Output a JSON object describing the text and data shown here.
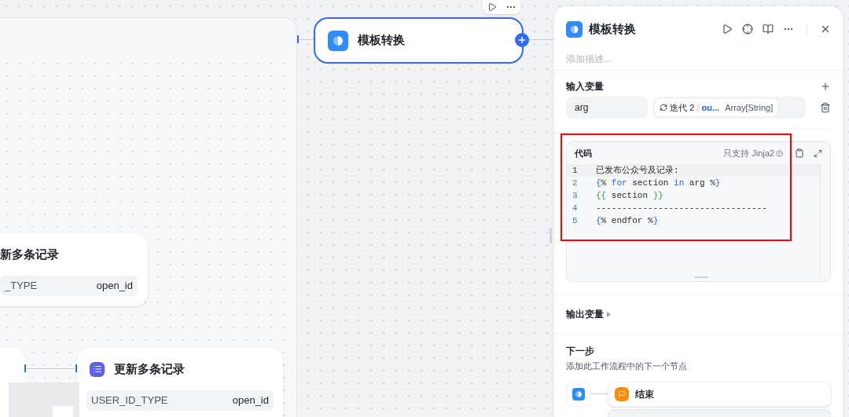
{
  "canvas": {
    "nodes": [
      {
        "title": "新多条记录",
        "param_name": "_TYPE",
        "param_value": "open_id"
      },
      {
        "title": "更新多条记录",
        "param_name": "USER_ID_TYPE",
        "param_value": "open_id"
      }
    ],
    "template_node": {
      "title": "模板转换",
      "selected": true
    }
  },
  "panel": {
    "title": "模板转换",
    "description_placeholder": "添加描述...",
    "input_section": "输入变量",
    "inputs": [
      {
        "name": "arg",
        "source": "迭代 2",
        "separator": "/",
        "variable": "ou...",
        "type": "Array[String]"
      }
    ],
    "code": {
      "label": "代码",
      "hint": "只支持 Jinja2",
      "lines": [
        {
          "number": "1",
          "tokens": [
            {
              "text": "已发布公众号及记录:",
              "kind": "plain"
            }
          ]
        },
        {
          "number": "2",
          "tokens": [
            {
              "text": "{",
              "kind": "bracket"
            },
            {
              "text": "% ",
              "kind": "plain"
            },
            {
              "text": "for",
              "kind": "keyword"
            },
            {
              "text": " section ",
              "kind": "plain"
            },
            {
              "text": "in",
              "kind": "keyword"
            },
            {
              "text": " arg %",
              "kind": "plain"
            },
            {
              "text": "}",
              "kind": "bracket"
            }
          ]
        },
        {
          "number": "3",
          "tokens": [
            {
              "text": "{{",
              "kind": "bracket2"
            },
            {
              "text": " section ",
              "kind": "plain"
            },
            {
              "text": "}}",
              "kind": "bracket2"
            }
          ]
        },
        {
          "number": "4",
          "tokens": [
            {
              "text": "---------------------------------",
              "kind": "plain"
            }
          ]
        },
        {
          "number": "5",
          "tokens": [
            {
              "text": "{",
              "kind": "bracket"
            },
            {
              "text": "% endfor %",
              "kind": "plain"
            },
            {
              "text": "}",
              "kind": "bracket"
            }
          ]
        }
      ]
    },
    "output_section": "输出变量",
    "next_step": {
      "title": "下一步",
      "description": "添加此工作流程中的下一个节点",
      "nodes": [
        {
          "title": "结束"
        }
      ]
    }
  }
}
